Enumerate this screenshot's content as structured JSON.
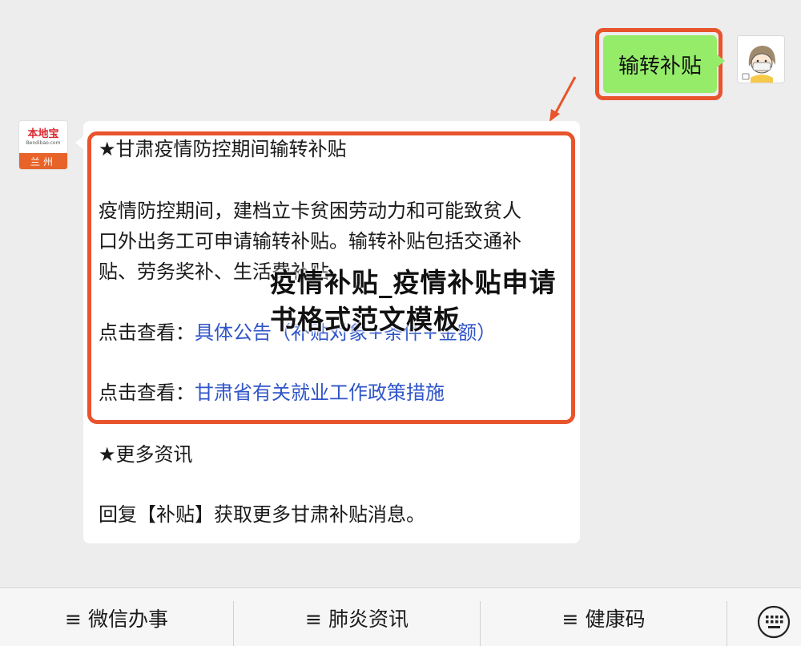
{
  "user_message": {
    "text": "输转补贴"
  },
  "bot": {
    "avatar_logo": "本地宝",
    "avatar_url": "Bendibao.com",
    "avatar_city": "兰州"
  },
  "bot_message": {
    "heading": "★甘肃疫情防控期间输转补贴",
    "para_lines": [
      "疫情防控期间，建档立卡贫困劳动力和可能致贫人",
      "口外出务工可申请输转补贴。输转补贴包括交通补",
      "贴、劳务奖补、生活费补贴。"
    ],
    "view1_prefix": "点击查看：",
    "view1_link": "具体公告（补贴对象+条件+金额）",
    "view2_prefix": "点击查看：",
    "view2_link": "甘肃省有关就业工作政策措施",
    "more_heading": "★更多资讯",
    "reply_text": "回复【补贴】获取更多甘肃补贴消息。"
  },
  "overlay_title": "疫情补贴_疫情补贴申请书格式范文模板",
  "menu": {
    "items": [
      {
        "label": "≡ 微信办事"
      },
      {
        "label": "≡ 肺炎资讯"
      },
      {
        "label": "≡ 健康码"
      }
    ]
  },
  "colors": {
    "highlight": "#e8542c",
    "user_bubble": "#95ec69",
    "link": "#2f55c8"
  }
}
